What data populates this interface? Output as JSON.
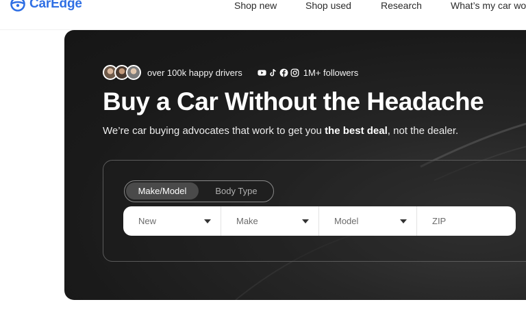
{
  "brand": {
    "name": "CarEdge",
    "color": "#2f6fe4"
  },
  "nav": {
    "items": [
      {
        "label": "Shop new"
      },
      {
        "label": "Shop used"
      },
      {
        "label": "Research"
      },
      {
        "label": "What’s my car wo"
      }
    ]
  },
  "hero": {
    "drivers_text": "over 100k happy drivers",
    "social_icons": [
      "youtube-icon",
      "tiktok-icon",
      "facebook-icon",
      "instagram-icon"
    ],
    "followers_text": "1M+ followers",
    "headline": "Buy a Car Without the Headache",
    "sub_prefix": "We’re car buying advocates that work to get you ",
    "sub_bold": "the best deal",
    "sub_suffix": ", not the dealer."
  },
  "search": {
    "tabs": [
      {
        "label": "Make/Model",
        "active": true
      },
      {
        "label": "Body Type",
        "active": false
      }
    ],
    "fields": {
      "condition": "New",
      "make": "Make",
      "model": "Model",
      "zip": "ZIP"
    }
  }
}
